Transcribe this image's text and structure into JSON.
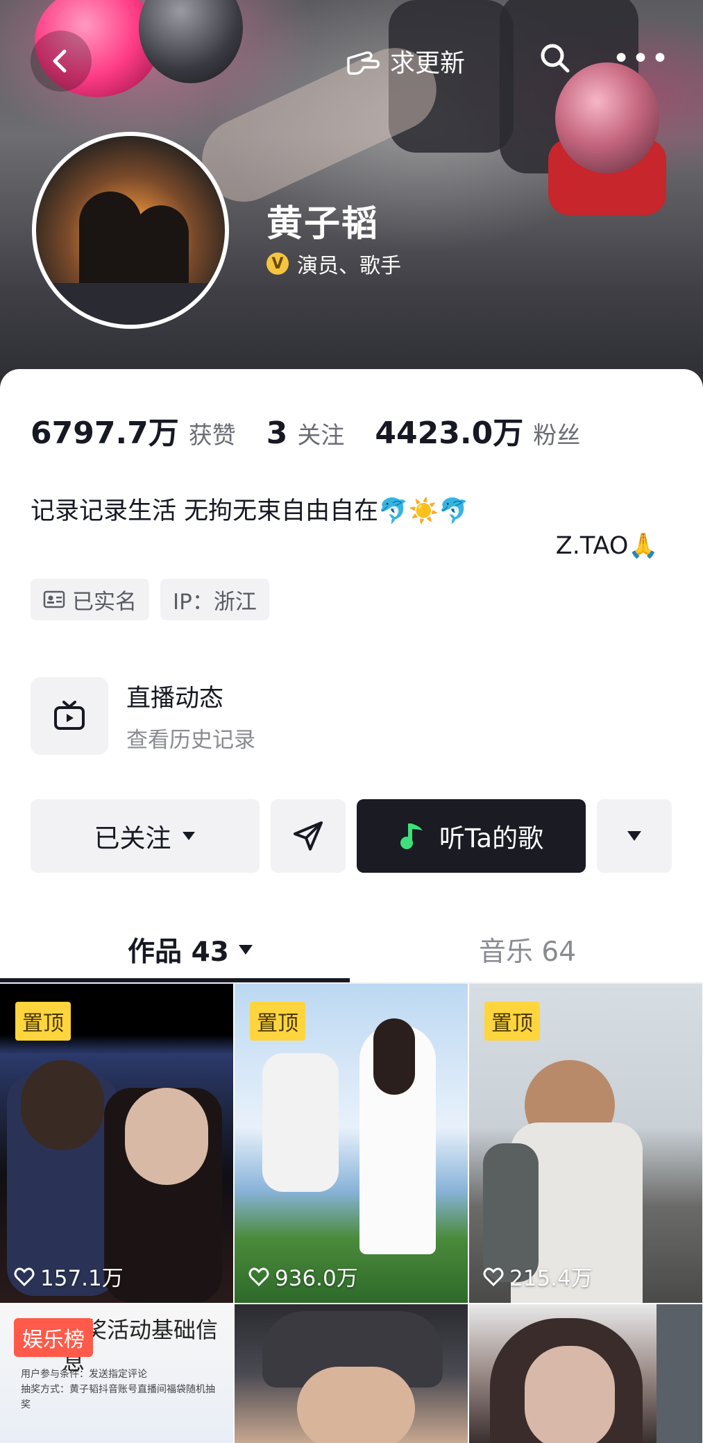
{
  "header": {
    "update_label": "求更新",
    "name": "黄子韬",
    "verify_badge": "V",
    "verify_title": "演员、歌手",
    "more_label": "•••"
  },
  "stats": [
    {
      "value": "6797.7万",
      "label": "获赞"
    },
    {
      "value": "3",
      "label": "关注"
    },
    {
      "value": "4423.0万",
      "label": "粉丝"
    }
  ],
  "bio": {
    "line1": "记录记录生活 无拘无束自由自在🐬☀️🐬",
    "signature": "Z.TAO🙏"
  },
  "tags": [
    {
      "icon": "id-card-icon",
      "label": "已实名"
    },
    {
      "label": "IP：浙江"
    }
  ],
  "live": {
    "title": "直播动态",
    "subtitle": "查看历史记录"
  },
  "actions": {
    "follow_label": "已关注",
    "song_label": "听Ta的歌"
  },
  "tabs": {
    "works_label": "作品 43",
    "music_label": "音乐 64"
  },
  "grid": {
    "pin_label": "置顶",
    "rank_label": "娱乐榜",
    "poster_head": "抽奖活动基础信息",
    "poster_lines": [
      "用户参与条件：发送指定评论",
      "抽奖方式：黄子韬抖音账号直播间福袋随机抽奖"
    ],
    "items": [
      {
        "likes": "157.1万"
      },
      {
        "likes": "936.0万"
      },
      {
        "likes": "215.4万"
      }
    ]
  },
  "colors": {
    "accent_dark": "#1a1b23",
    "pin_yellow": "#ffd53d",
    "rank_red": "#ff5a4a",
    "verify_gold": "#f5c53e"
  }
}
